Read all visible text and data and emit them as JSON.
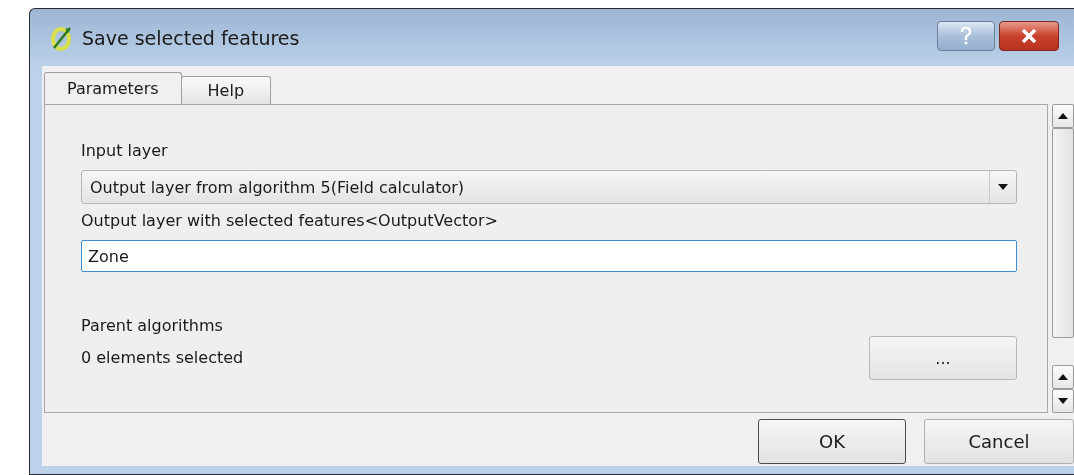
{
  "window": {
    "title": "Save selected features"
  },
  "tabs": [
    {
      "label": "Parameters",
      "selected": true
    },
    {
      "label": "Help",
      "selected": false
    }
  ],
  "parameters": {
    "input_layer": {
      "label": "Input layer",
      "value": "Output layer from algorithm 5(Field calculator)"
    },
    "output_layer": {
      "label": "Output layer with selected features<OutputVector>",
      "value": "Zone"
    },
    "parent_algorithms": {
      "label": "Parent algorithms",
      "status": "0 elements selected",
      "button": "..."
    }
  },
  "buttons": [
    "OK",
    "Cancel"
  ]
}
